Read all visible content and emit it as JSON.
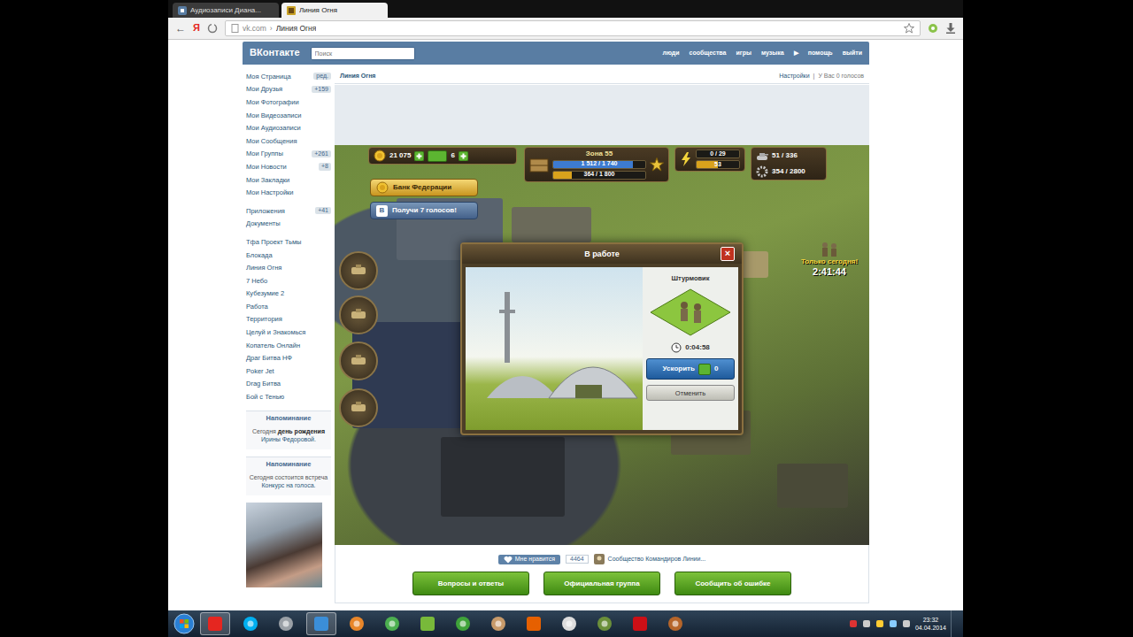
{
  "browser": {
    "tabs": [
      {
        "label": "Аудиозаписи Диана...",
        "selected": false
      },
      {
        "label": "Линия Огня",
        "selected": true
      }
    ],
    "back": "←",
    "yandex": "Я",
    "address": {
      "host": "vk.com",
      "separator": "›",
      "title": "Линия Огня"
    }
  },
  "vk": {
    "logo": "ВКонтакте",
    "search": {
      "placeholder": "Поиск"
    },
    "nav": [
      "люди",
      "сообщества",
      "игры",
      "музыка",
      "▶",
      "помощь",
      "выйти"
    ],
    "menu": [
      {
        "label": "Моя Страница",
        "badge": "ред."
      },
      {
        "label": "Мои Друзья",
        "badge": "+159"
      },
      {
        "label": "Мои Фотографии"
      },
      {
        "label": "Мои Видеозаписи"
      },
      {
        "label": "Мои Аудиозаписи"
      },
      {
        "label": "Мои Сообщения"
      },
      {
        "label": "Мои Группы",
        "badge": "+261"
      },
      {
        "label": "Мои Новости",
        "badge": "+8"
      },
      {
        "label": "Мои Закладки"
      },
      {
        "label": "Мои Настройки"
      }
    ],
    "sections": [
      {
        "label": "Приложения",
        "badge": "+41"
      },
      {
        "label": "Документы"
      }
    ],
    "apps": [
      "Тфа Проект Тьмы",
      "Блокада",
      "Линия Огня",
      "7 Небо",
      "Кубезумие 2",
      "Работа",
      "Территория",
      "Целуй и Знакомься",
      "Копатель Онлайн",
      "Драг Битва НФ",
      "Poker Jet",
      "Drag Битва",
      "Бой с Тенью"
    ],
    "reminders": [
      {
        "title": "Напоминание",
        "parts": [
          {
            "text": "Сегодня ",
            "kind": "plain"
          },
          {
            "text": "день рождения",
            "kind": "bold"
          },
          {
            "text": " Ирины Федоровой",
            "kind": "link"
          },
          {
            "text": ".",
            "kind": "plain"
          }
        ]
      },
      {
        "title": "Напоминание",
        "parts": [
          {
            "text": "Сегодня состоится встреча ",
            "kind": "plain"
          },
          {
            "text": "Конкурс на голоса",
            "kind": "link"
          },
          {
            "text": ".",
            "kind": "plain"
          }
        ]
      }
    ]
  },
  "app": {
    "title": "Линия Огня",
    "settings": "Настройки",
    "divider": "|",
    "votes": "У Вас 0 голосов",
    "like": "Мне нравится",
    "like_count": "4464",
    "community": "Сообщество Командиров Линии...",
    "buttons": [
      "Вопросы и ответы",
      "Официальная группа",
      "Сообщить об ошибке"
    ]
  },
  "game": {
    "coins": "21 075",
    "gems": "6",
    "bank": "Банк Федерации",
    "votes_offer": "Получи 7 голосов!",
    "vk_letter": "В",
    "zone": {
      "title": "Зона 55",
      "xp": {
        "reading": "1 512 / 1 740",
        "level": 0.87
      },
      "sub": {
        "reading": "364 / 1 800",
        "level": 0.2
      }
    },
    "energy": {
      "reading": "0 / 29",
      "level": 0,
      "bonus": {
        "reading": "53",
        "level": 0.5
      }
    },
    "resources": [
      {
        "reading": "51 / 336"
      },
      {
        "reading": "354 / 2800"
      }
    ],
    "offer": {
      "label": "Только сегодня!",
      "timer": "2:41:44"
    },
    "dialog": {
      "title": "В работе",
      "close": "×",
      "unit": "Штурмовик",
      "timer": "0:04:58",
      "speed_up": "Ускорить",
      "speed_up_cost": "0",
      "cancel": "Отменить"
    }
  },
  "taskbar": {
    "apps": [
      {
        "selected": true
      },
      {
        "selected": false
      },
      {
        "selected": false
      },
      {
        "selected": true
      },
      {
        "selected": false
      },
      {
        "selected": false
      },
      {
        "selected": false
      },
      {
        "selected": false
      },
      {
        "selected": false
      },
      {
        "selected": false
      },
      {
        "selected": false
      },
      {
        "selected": false
      },
      {
        "selected": false
      },
      {
        "selected": false
      }
    ],
    "time": "23:32",
    "date": "04.04.2014"
  }
}
